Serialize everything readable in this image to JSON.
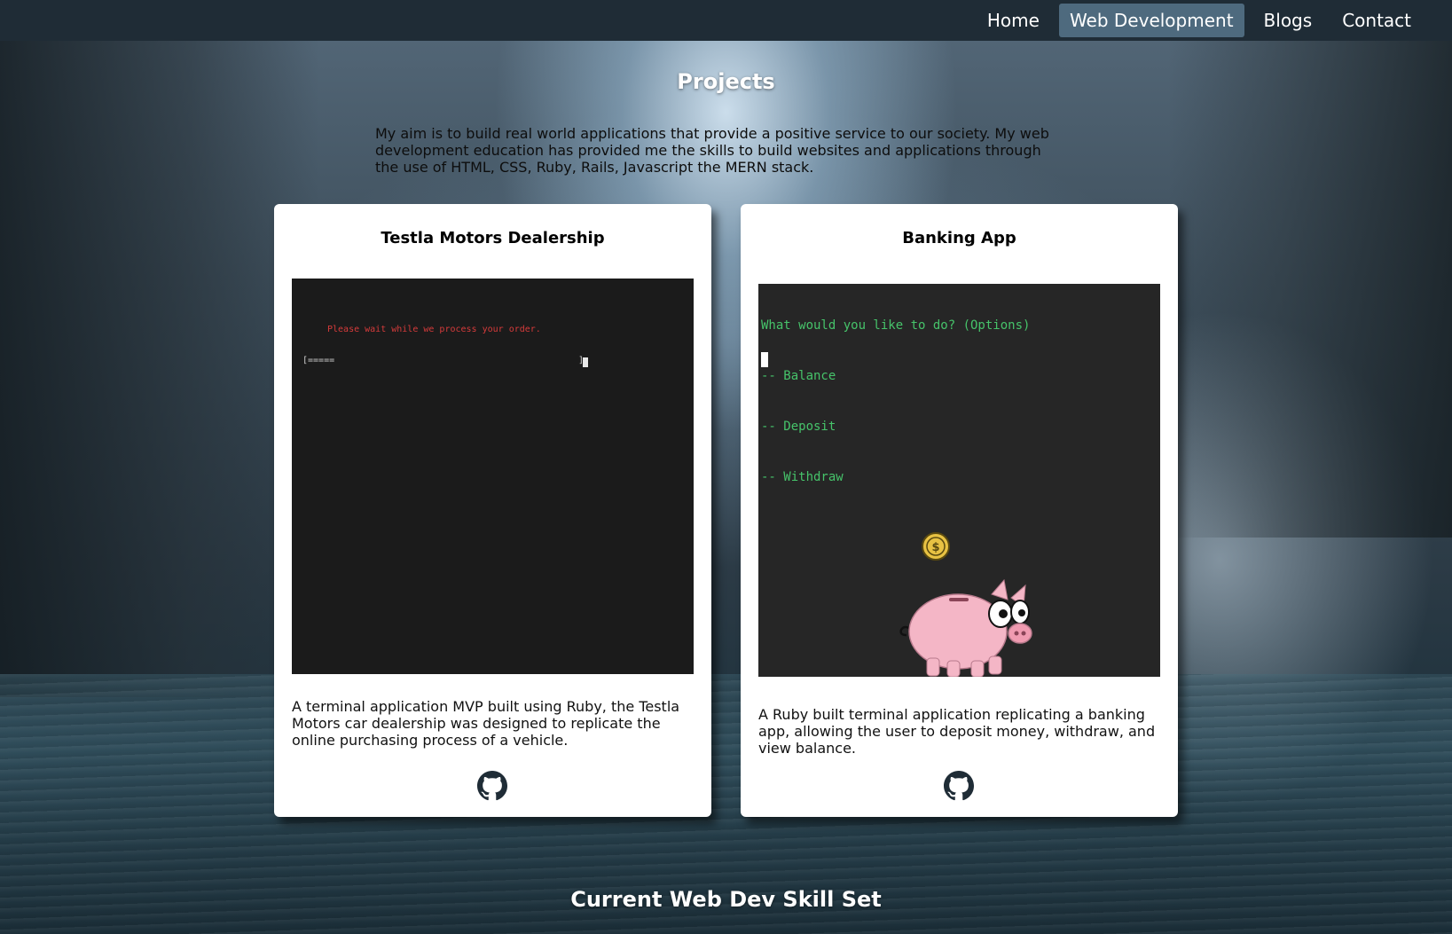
{
  "nav": {
    "items": [
      {
        "label": "Home",
        "active": false
      },
      {
        "label": "Web Development",
        "active": true
      },
      {
        "label": "Blogs",
        "active": false
      },
      {
        "label": "Contact",
        "active": false
      }
    ]
  },
  "projects": {
    "title": "Projects",
    "intro": "My aim is to build real world applications that provide a positive service to our society. My web development education has provided me the skills to build websites and applications through the use of HTML, CSS, Ruby, Rails, Javascript the MERN stack.",
    "cards": [
      {
        "title": "Testla Motors Dealership",
        "screen": {
          "message": "Please wait while we process your order.",
          "progress_left": "[=====",
          "progress_right": "]"
        },
        "description": "A terminal application MVP built using Ruby, the Testla Motors car dealership was designed to replicate the online purchasing process of a vehicle.",
        "link_icon": "github-icon"
      },
      {
        "title": "Banking App",
        "screen": {
          "lines": [
            "What would you like to do? (Options)",
            "-- Balance",
            "-- Deposit",
            "-- Withdraw"
          ]
        },
        "description": "A Ruby built terminal application replicating a banking app, allowing the user to deposit money, withdraw, and view balance.",
        "link_icon": "github-icon"
      }
    ]
  },
  "skills": {
    "title": "Current Web Dev Skill Set"
  },
  "colors": {
    "navbar_bg": "#1f2c36",
    "nav_active_bg": "#4e6a7e",
    "terminal_green": "#46c36a",
    "terminal_red": "#d63b3b",
    "pig_pink": "#f4b6c6",
    "coin_gold": "#e8c243"
  }
}
